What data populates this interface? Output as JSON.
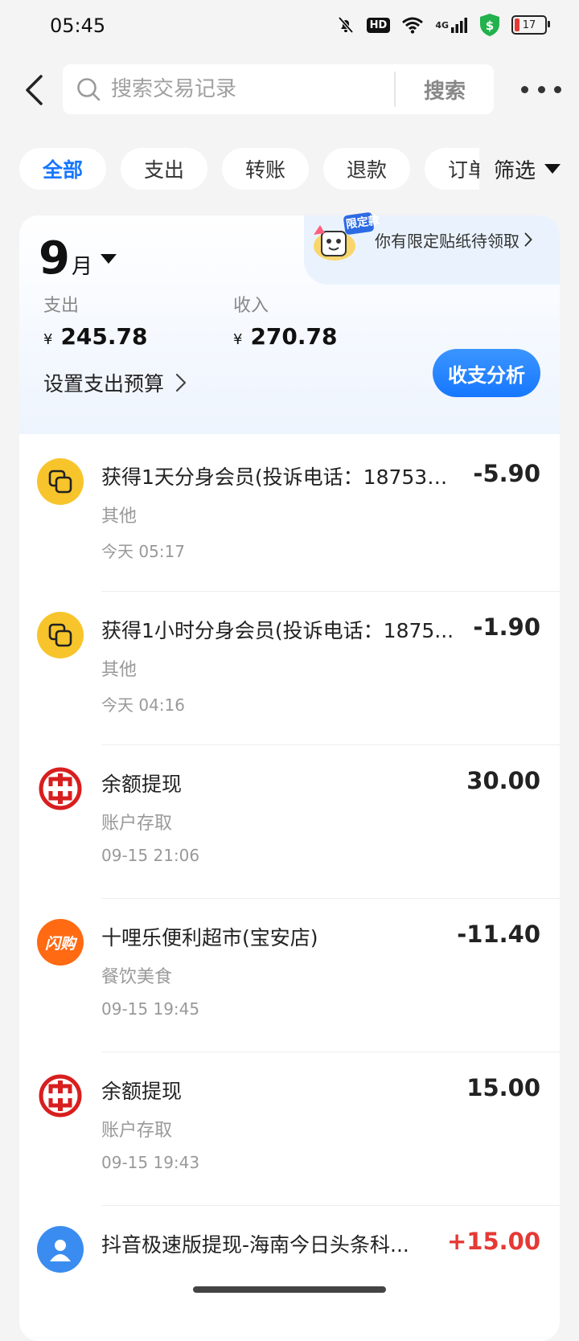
{
  "status_bar": {
    "time": "05:45",
    "hd_label": "HD",
    "network_label": "4G",
    "battery_level": "17"
  },
  "header": {
    "search_placeholder": "搜索交易记录",
    "search_button": "搜索"
  },
  "filters": {
    "tabs": [
      "全部",
      "支出",
      "转账",
      "退款",
      "订单"
    ],
    "active_index": 0,
    "filter_label": "筛选"
  },
  "banner": {
    "sticker_badge": "限定款",
    "text": "你有限定贴纸待领取"
  },
  "summary": {
    "month": "9",
    "month_unit": "月",
    "expense_label": "支出",
    "expense_currency": "¥",
    "expense_value": "245.78",
    "income_label": "收入",
    "income_currency": "¥",
    "income_value": "270.78",
    "budget_link": "设置支出预算",
    "analysis_button": "收支分析"
  },
  "transactions": [
    {
      "title": "获得1天分身会员(投诉电话：187532...",
      "category": "其他",
      "time": "今天 05:17",
      "amount": "-5.90",
      "icon": "copy-icon",
      "color": "#f7c52b"
    },
    {
      "title": "获得1小时分身会员(投诉电话：1875...",
      "category": "其他",
      "time": "今天 04:16",
      "amount": "-1.90",
      "icon": "copy-icon",
      "color": "#f7c52b"
    },
    {
      "title": "余额提现",
      "category": "账户存取",
      "time": "09-15 21:06",
      "amount": "30.00",
      "icon": "icbc-logo-icon",
      "color": "#d81e1e"
    },
    {
      "title": "十哩乐便利超市(宝安店)",
      "category": "餐饮美食",
      "time": "09-15 19:45",
      "amount": "-11.40",
      "icon": "shangou-logo-icon",
      "color": "#ff6a12",
      "icon_text": "闪购"
    },
    {
      "title": "余额提现",
      "category": "账户存取",
      "time": "09-15 19:43",
      "amount": "15.00",
      "icon": "icbc-logo-icon",
      "color": "#d81e1e"
    },
    {
      "title": "抖音极速版提现-海南今日头条科...",
      "category": "",
      "time": "",
      "amount": "+15.00",
      "icon": "person-icon",
      "color": "#3a8cf0"
    }
  ]
}
